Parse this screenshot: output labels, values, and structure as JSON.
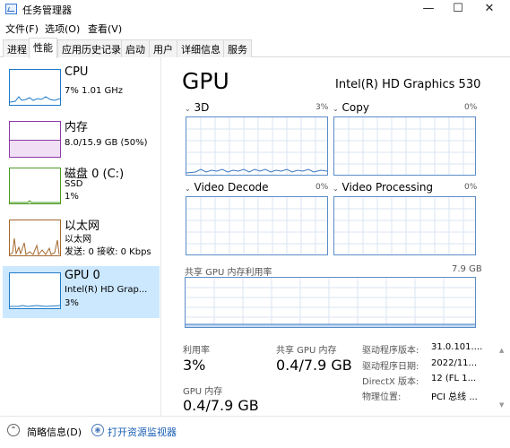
{
  "window": {
    "title": "任务管理器",
    "minimize_icon": "minimize-icon",
    "maximize_icon": "maximize-icon",
    "close_icon": "close-icon"
  },
  "menu": [
    "文件(F)",
    "选项(O)",
    "查看(V)"
  ],
  "tabs": [
    "进程",
    "性能",
    "应用历史记录",
    "启动",
    "用户",
    "详细信息",
    "服务"
  ],
  "active_tab": "性能",
  "sidebar": {
    "items": [
      {
        "title": "CPU",
        "line1": "7% 1.01 GHz",
        "line2": "",
        "color": "#1e7ac9"
      },
      {
        "title": "内存",
        "line1": "8.0/15.9 GB (50%)",
        "line2": "",
        "color": "#8b3aa8"
      },
      {
        "title": "磁盘 0 (C:)",
        "line1": "SSD",
        "line2": "1%",
        "color": "#4a9a1f"
      },
      {
        "title": "以太网",
        "line1": "以太网",
        "line2": "发送: 0 接收: 0 Kbps",
        "color": "#a4672c"
      },
      {
        "title": "GPU 0",
        "line1": "Intel(R) HD Grap...",
        "line2": "3%",
        "color": "#1e7ac9"
      }
    ]
  },
  "main": {
    "heading": "GPU",
    "model": "Intel(R) HD Graphics 530",
    "engines": [
      {
        "label": "3D",
        "percent": "3%"
      },
      {
        "label": "Copy",
        "percent": "0%"
      },
      {
        "label": "Video Decode",
        "percent": "0%"
      },
      {
        "label": "Video Processing",
        "percent": "0%"
      }
    ],
    "shared_memory": {
      "label": "共享 GPU 内存利用率",
      "max": "7.9 GB"
    },
    "stats": {
      "utilization_label": "利用率",
      "utilization_value": "3%",
      "shared_mem_label": "共享 GPU 内存",
      "shared_mem_value": "0.4/7.9 GB",
      "gpu_mem_label": "GPU 内存",
      "gpu_mem_value": "0.4/7.9 GB"
    },
    "info": [
      {
        "key": "驱动程序版本:",
        "value": "31.0.101...."
      },
      {
        "key": "驱动程序日期:",
        "value": "2022/11..."
      },
      {
        "key": "DirectX 版本:",
        "value": "12 (FL 1..."
      },
      {
        "key": "物理位置:",
        "value": "PCI 总线 ..."
      }
    ]
  },
  "footer": {
    "summary": "简略信息(D)",
    "resource_monitor": "打开资源监视器"
  },
  "colors": {
    "accent_selected": "#cce8ff",
    "graph_border": "#5b8dc9"
  }
}
